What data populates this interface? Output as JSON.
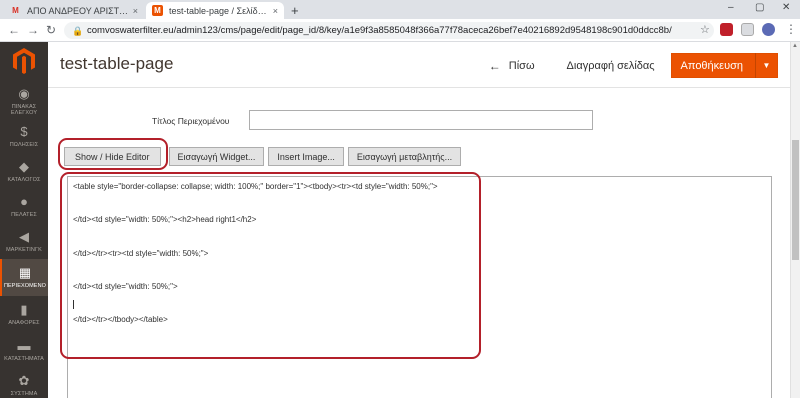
{
  "browser": {
    "tabs": [
      {
        "label": "ΑΠΟ ΑΝΔΡΕΟΥ ΑΡΙΣΤΟΤΕΛΗΣ - ",
        "icon": "gmail-icon"
      },
      {
        "label": "test-table-page / Σελίδες / Eleme",
        "icon": "magento-icon"
      }
    ],
    "url": "comvoswaterfilter.eu/admin123/cms/page/edit/page_id/8/key/a1e9f3a8585048f366a77f78aceca26bef7e40216892d9548198c901d0ddcc8b/",
    "new_tab": "+",
    "tab_close": "×",
    "window_controls": [
      "–",
      "▢",
      "✕"
    ]
  },
  "sidebar": {
    "items": [
      {
        "label": "ΠΙΝΑΚΑΣ ΕΛΕΓΧΟΥ",
        "icon": "dashboard-icon",
        "glyph": "◉"
      },
      {
        "label": "ΠΩΛΗΣΕΙΣ",
        "icon": "dollar-icon",
        "glyph": "$"
      },
      {
        "label": "ΚΑΤΑΛΟΓΟΣ",
        "icon": "box-icon",
        "glyph": "◆"
      },
      {
        "label": "ΠΕΛΑΤΕΣ",
        "icon": "person-icon",
        "glyph": "●"
      },
      {
        "label": "ΜΑΡΚΕΤΙΝΓΚ",
        "icon": "megaphone-icon",
        "glyph": "◀"
      },
      {
        "label": "ΠΕΡΙΕΧΟΜΕΝΟ",
        "icon": "content-icon",
        "glyph": "▦"
      },
      {
        "label": "ΑΝΑΦΟΡΕΣ",
        "icon": "bar-chart-icon",
        "glyph": "▮"
      },
      {
        "label": "ΚΑΤΑΣΤΗΜΑΤΑ",
        "icon": "store-icon",
        "glyph": "▬"
      },
      {
        "label": "ΣΥΣΤΗΜΑ",
        "icon": "gear-icon",
        "glyph": "✿"
      }
    ],
    "active_index": 5
  },
  "header": {
    "title": "test-table-page",
    "back_label": "Πίσω",
    "delete_label": "Διαγραφή σελίδας",
    "save_label": "Αποθήκευση"
  },
  "form": {
    "content_title_label": "Τίτλος Περιεχομένου",
    "content_title_value": "",
    "buttons": {
      "show_hide": "Show / Hide Editor",
      "insert_widget": "Εισαγωγή Widget...",
      "insert_image": "Insert Image...",
      "insert_variable": "Εισαγωγή μεταβλητής..."
    },
    "editor_lines": [
      "<table style=\"border-collapse: collapse; width: 100%;\" border=\"1\"><tbody><tr><td style=\"width: 50%;\">",
      "</td><td style=\"width: 50%;\"><h2>head right1</h2>",
      "</td></tr><tr><td style=\"width: 50%;\">",
      "</td><td style=\"width: 50%;\">",
      "</td></tr></tbody></table>"
    ]
  },
  "colors": {
    "accent": "#eb5202",
    "sidebar": "#373330",
    "highlight": "#b3202a"
  }
}
